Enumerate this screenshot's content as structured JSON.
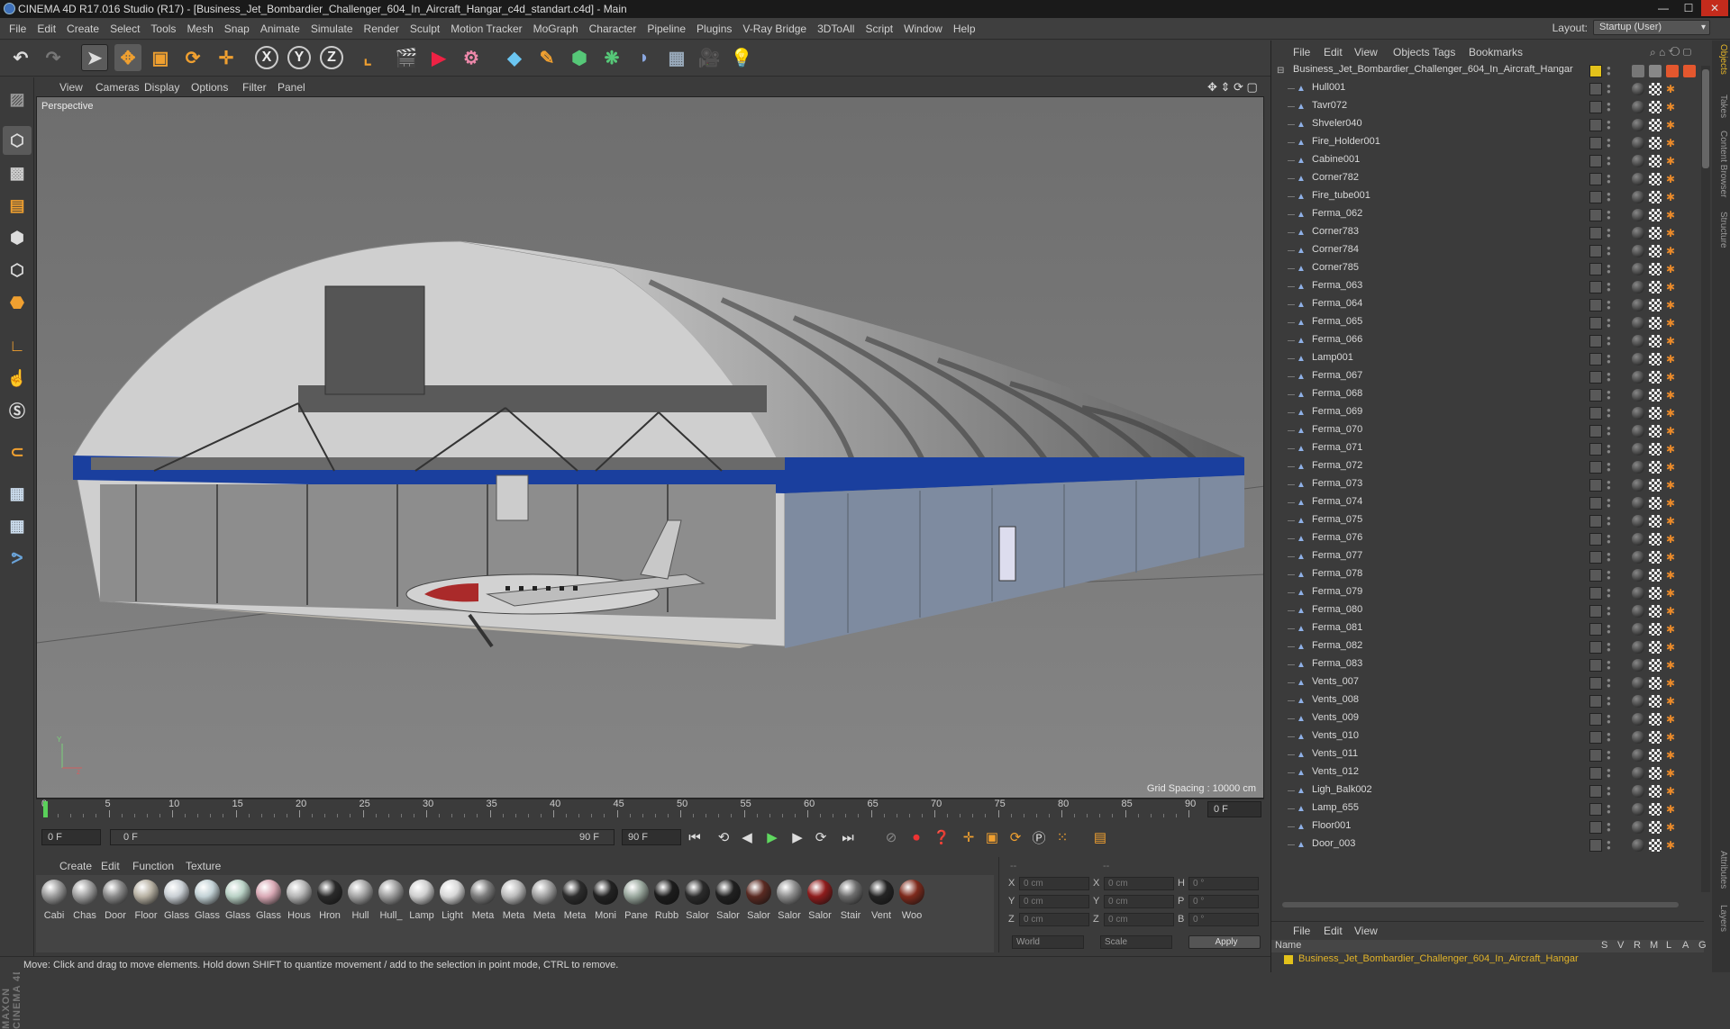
{
  "window": {
    "title": "CINEMA 4D R17.016 Studio (R17) - [Business_Jet_Bombardier_Challenger_604_In_Aircraft_Hangar_c4d_standart.c4d] - Main"
  },
  "menu": [
    "File",
    "Edit",
    "Create",
    "Select",
    "Tools",
    "Mesh",
    "Snap",
    "Animate",
    "Simulate",
    "Render",
    "Sculpt",
    "Motion Tracker",
    "MoGraph",
    "Character",
    "Pipeline",
    "Plugins",
    "V-Ray Bridge",
    "3DToAll",
    "Script",
    "Window",
    "Help"
  ],
  "layout": {
    "label": "Layout:",
    "value": "Startup (User)"
  },
  "viewport": {
    "menu": [
      "View",
      "Cameras",
      "Display",
      "Options",
      "Filter",
      "Panel"
    ],
    "label": "Perspective",
    "grid_spacing": "Grid Spacing : 10000 cm"
  },
  "timeline": {
    "ticks": [
      "0",
      "5",
      "10",
      "15",
      "20",
      "25",
      "30",
      "35",
      "40",
      "45",
      "50",
      "55",
      "60",
      "65",
      "70",
      "75",
      "80",
      "85",
      "90"
    ],
    "end_field": "0 F"
  },
  "playbar": {
    "current_frame": "0 F",
    "range_start": "0 F",
    "range_end": "90 F",
    "max_frame": "90 F"
  },
  "material_menu": [
    "Create",
    "Edit",
    "Function",
    "Texture"
  ],
  "materials": [
    {
      "name": "Cabi",
      "color": "#9a9a9a"
    },
    {
      "name": "Chas",
      "color": "#a0a0a0"
    },
    {
      "name": "Door",
      "color": "#8a8a8a"
    },
    {
      "name": "Floor",
      "color": "#b8b2a4"
    },
    {
      "name": "Glass",
      "color": "#c9cfd4"
    },
    {
      "name": "Glass",
      "color": "#c3d2d6"
    },
    {
      "name": "Glass",
      "color": "#b9d1c5"
    },
    {
      "name": "Glass",
      "color": "#d9a9b5"
    },
    {
      "name": "Hous",
      "color": "#b5b5b5"
    },
    {
      "name": "Hron",
      "color": "#2a2a2a"
    },
    {
      "name": "Hull",
      "color": "#a5a5a5"
    },
    {
      "name": "Hull_",
      "color": "#9e9e9e"
    },
    {
      "name": "Lamp",
      "color": "#cfcfcf"
    },
    {
      "name": "Light",
      "color": "#d8d8d8"
    },
    {
      "name": "Meta",
      "color": "#7d7d7d"
    },
    {
      "name": "Meta",
      "color": "#bdbdbd"
    },
    {
      "name": "Meta",
      "color": "#a2a2a2"
    },
    {
      "name": "Meta",
      "color": "#2c2c2c"
    },
    {
      "name": "Moni",
      "color": "#222222"
    },
    {
      "name": "Pane",
      "color": "#9aa89e"
    },
    {
      "name": "Rubb",
      "color": "#1c1c1c"
    },
    {
      "name": "Salor",
      "color": "#2b2b2b"
    },
    {
      "name": "Salor",
      "color": "#202020"
    },
    {
      "name": "Salor",
      "color": "#5a2a22"
    },
    {
      "name": "Salor",
      "color": "#8e8e8e"
    },
    {
      "name": "Salor",
      "color": "#8e1c1c"
    },
    {
      "name": "Stair",
      "color": "#6d6d6d"
    },
    {
      "name": "Vent",
      "color": "#242424"
    },
    {
      "name": "Woo",
      "color": "#7e2a1c"
    }
  ],
  "coords": {
    "header": "--",
    "header2": "--",
    "rows": [
      {
        "a": "X",
        "av": "0 cm",
        "b": "X",
        "bv": "0 cm",
        "c": "H",
        "cv": "0 °"
      },
      {
        "a": "Y",
        "av": "0 cm",
        "b": "Y",
        "bv": "0 cm",
        "c": "P",
        "cv": "0 °"
      },
      {
        "a": "Z",
        "av": "0 cm",
        "b": "Z",
        "bv": "0 cm",
        "c": "B",
        "cv": "0 °"
      }
    ],
    "world": "World",
    "scale": "Scale",
    "apply": "Apply"
  },
  "status": "Move: Click and drag to move elements. Hold down SHIFT to quantize movement / add to the selection in point mode, CTRL to remove.",
  "objects_menu": [
    "File",
    "Edit",
    "View",
    "Objects",
    "Tags",
    "Bookmarks"
  ],
  "root_object": "Business_Jet_Bombardier_Challenger_604_In_Aircraft_Hangar",
  "objects": [
    "Hull001",
    "Tavr072",
    "Shveler040",
    "Fire_Holder001",
    "Cabine001",
    "Corner782",
    "Fire_tube001",
    "Ferma_062",
    "Corner783",
    "Corner784",
    "Corner785",
    "Ferma_063",
    "Ferma_064",
    "Ferma_065",
    "Ferma_066",
    "Lamp001",
    "Ferma_067",
    "Ferma_068",
    "Ferma_069",
    "Ferma_070",
    "Ferma_071",
    "Ferma_072",
    "Ferma_073",
    "Ferma_074",
    "Ferma_075",
    "Ferma_076",
    "Ferma_077",
    "Ferma_078",
    "Ferma_079",
    "Ferma_080",
    "Ferma_081",
    "Ferma_082",
    "Ferma_083",
    "Vents_007",
    "Vents_008",
    "Vents_009",
    "Vents_010",
    "Vents_011",
    "Vents_012",
    "Ligh_Balk002",
    "Lamp_655",
    "Floor001",
    "Door_003"
  ],
  "attr_menu": [
    "File",
    "Edit",
    "View"
  ],
  "layer": {
    "columns": [
      "Name",
      "S",
      "V",
      "R",
      "M",
      "L",
      "A",
      "G"
    ],
    "root": "Business_Jet_Bombardier_Challenger_604_In_Aircraft_Hangar"
  },
  "side_tabs": [
    "Objects",
    "Takes",
    "Content Browser",
    "Structure",
    "Attributes",
    "Layers"
  ],
  "brand": "MAXON CINEMA 4D"
}
